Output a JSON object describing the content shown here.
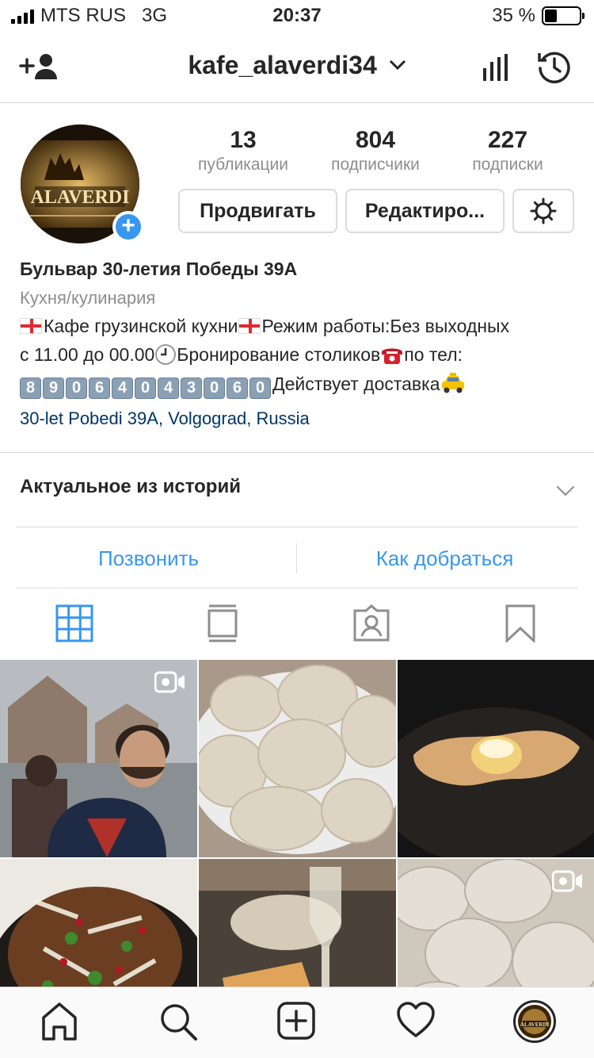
{
  "status_bar": {
    "carrier": "MTS RUS",
    "network": "3G",
    "time": "20:37",
    "battery": "35 %",
    "battery_level": 0.35
  },
  "header": {
    "username": "kafe_alaverdi34",
    "icons": [
      "add-user-icon",
      "chevron-down-icon",
      "insights-icon",
      "archive-clock-icon"
    ]
  },
  "profile": {
    "avatar_text": "ALAVERDI",
    "stats": [
      {
        "value": "13",
        "label": "публикации"
      },
      {
        "value": "804",
        "label": "подписчики"
      },
      {
        "value": "227",
        "label": "подписки"
      }
    ],
    "buttons": {
      "promote": "Продвигать",
      "edit": "Редактиро...",
      "settings_icon": "gear-icon"
    }
  },
  "bio": {
    "name": "Бульвар 30-летия Победы 39А",
    "category": "Кухня/кулинария",
    "line1_a": "Кафе грузинской кухни",
    "line1_b": "Режим работы:Без выходных",
    "line2_a": "с 11.00 до 00.00",
    "line2_b": "Бронирование столиков",
    "line2_c": "по тел:",
    "phone_digits": [
      "8",
      "9",
      "0",
      "6",
      "4",
      "0",
      "4",
      "3",
      "0",
      "6",
      "0"
    ],
    "line3": "Действует доставка",
    "address_link": "30-let Pobedi 39A, Volgograd, Russia"
  },
  "highlights": {
    "title": "Актуальное из историй"
  },
  "contact": {
    "call": "Позвонить",
    "directions": "Как добраться"
  },
  "tabs": [
    "grid-icon",
    "feed-icon",
    "tagged-icon",
    "saved-icon"
  ],
  "grid": [
    {
      "subject": "man-at-monastery",
      "video": true
    },
    {
      "subject": "khinkali-plate",
      "video": false
    },
    {
      "subject": "khachapuri-pan",
      "video": false
    },
    {
      "subject": "salad-with-pomegranate",
      "video": false
    },
    {
      "subject": "table-with-wine",
      "video": false
    },
    {
      "subject": "khinkali-closeup",
      "video": true
    }
  ],
  "bottom_nav": [
    "home-icon",
    "search-icon",
    "new-post-icon",
    "activity-heart-icon",
    "profile-avatar"
  ],
  "colors": {
    "accent_blue": "#3897f0",
    "link_navy": "#003569",
    "muted_gray": "#8e8e8e",
    "divider": "#dbdbdb"
  }
}
